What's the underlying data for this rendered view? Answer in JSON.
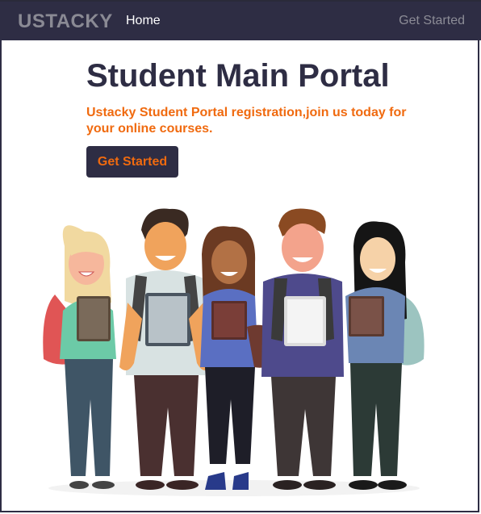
{
  "navbar": {
    "brand": "USTACKY",
    "home_label": "Home",
    "cta_label": "Get Started"
  },
  "hero": {
    "title": "Student Main Portal",
    "subtitle": "Ustacky Student Portal registration,join us today for your online courses.",
    "button_label": "Get Started"
  },
  "colors": {
    "navbar_bg": "#2e2d44",
    "accent_orange": "#f06a0f",
    "title_dark": "#2e2d44"
  },
  "illustration": {
    "icon": "students-group-illustration",
    "figures": 5
  }
}
